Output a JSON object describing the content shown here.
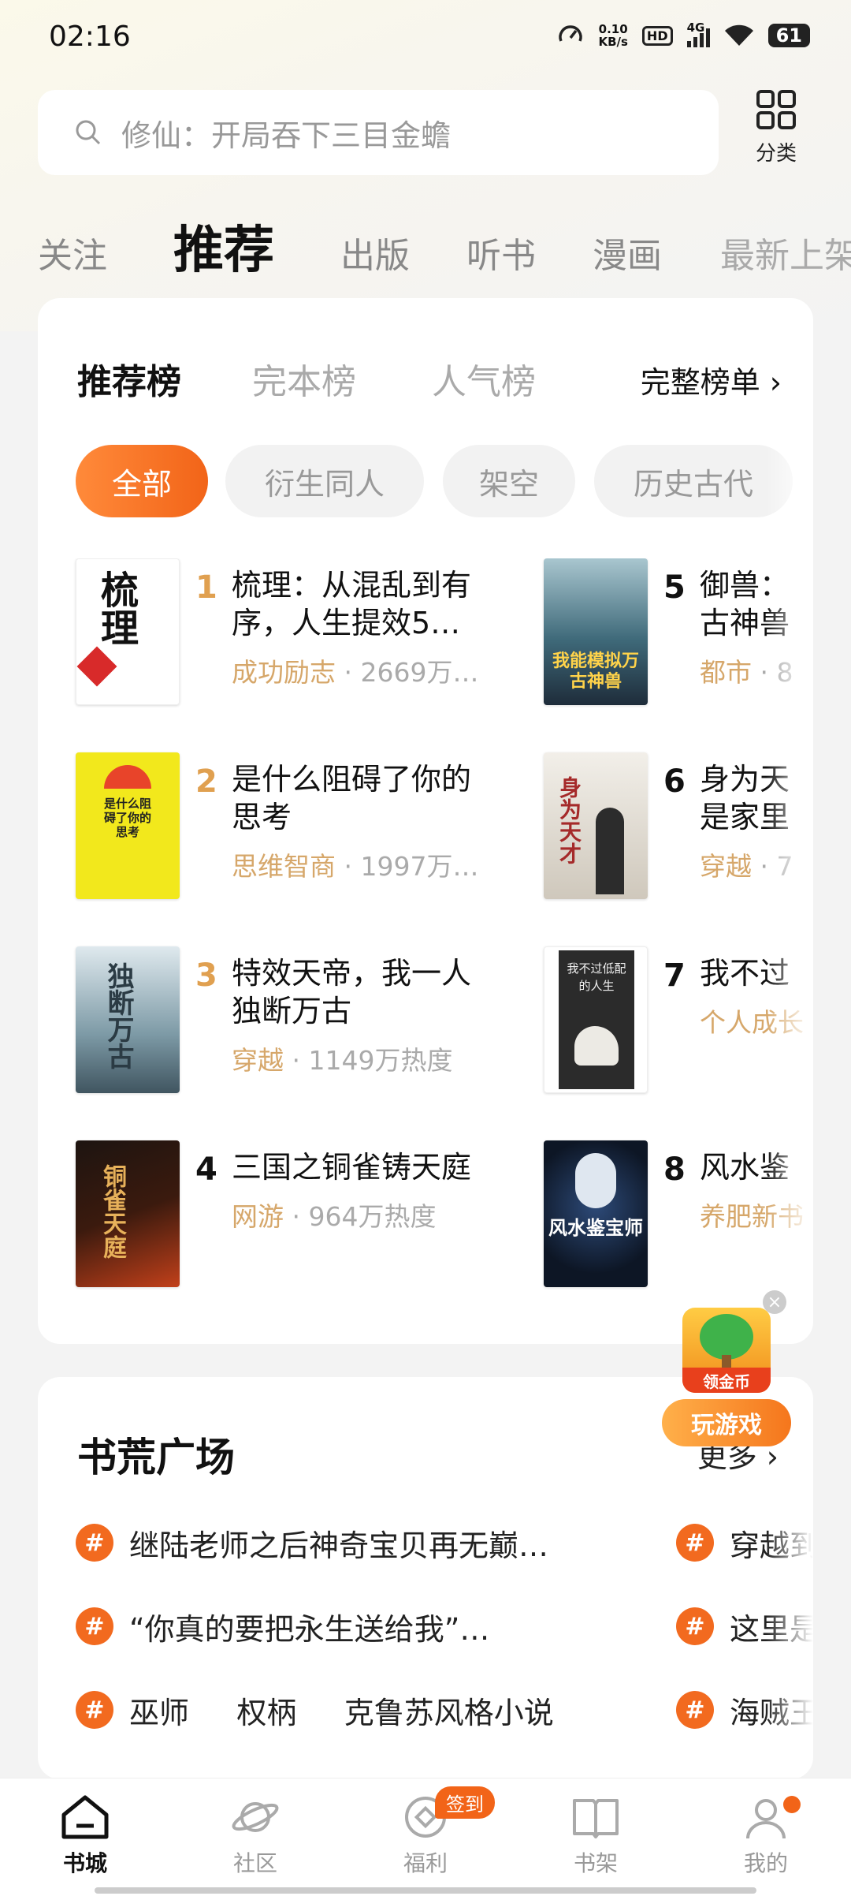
{
  "status": {
    "time": "02:16",
    "speed_value": "0.10",
    "speed_unit": "KB/s",
    "hd": "HD",
    "network": "4G",
    "battery": "61"
  },
  "search": {
    "placeholder": "修仙：开局吞下三目金蟾"
  },
  "category": {
    "label": "分类"
  },
  "tabs": [
    "关注",
    "推荐",
    "出版",
    "听书",
    "漫画",
    "最新上架"
  ],
  "ranking": {
    "tabs": [
      "推荐榜",
      "完本榜",
      "人气榜"
    ],
    "full_list": "完整榜单 ›",
    "chips": [
      "全部",
      "衍生同人",
      "架空",
      "历史古代"
    ],
    "books": [
      {
        "rank": "1",
        "title": "梳理：从混乱到有序，人生提效5…",
        "tag": "成功励志",
        "heat": " · 2669万…",
        "cover_text": "梳理"
      },
      {
        "rank": "2",
        "title": "是什么阻碍了你的思考",
        "tag": "思维智商",
        "heat": " · 1997万…",
        "cover_text": "是什么阻碍了你的思考"
      },
      {
        "rank": "3",
        "title": "特效天帝，我一人独断万古",
        "tag": "穿越",
        "heat": " · 1149万热度",
        "cover_text": "独断万古"
      },
      {
        "rank": "4",
        "title": "三国之铜雀铸天庭",
        "tag": "网游",
        "heat": " · 964万热度",
        "cover_text": "铜雀天庭"
      },
      {
        "rank": "5",
        "title": "御兽：",
        "title2": "古神兽",
        "tag": "都市",
        "heat": " · 8",
        "cover_text": "我能模拟万古神兽"
      },
      {
        "rank": "6",
        "title": "身为天",
        "title2": "是家里",
        "tag": "穿越",
        "heat": " · 7",
        "cover_text": "身为天才"
      },
      {
        "rank": "7",
        "title": "我不过",
        "tag": "个人成长",
        "heat": "",
        "cover_text": "我不过低配的人生"
      },
      {
        "rank": "8",
        "title": "风水鉴",
        "tag": "养肥新书",
        "heat": "",
        "cover_text": "风水鉴宝师"
      }
    ]
  },
  "plaza": {
    "title": "书荒广场",
    "more": "更多 ›",
    "topics_left": [
      "继陆老师之后神奇宝贝再无巅…",
      "“你真的要把永生送给我”…",
      "巫师     权柄     克鲁苏风格小说"
    ],
    "topics_right": [
      "穿越到",
      "这里是",
      "海贼王"
    ]
  },
  "float_game": {
    "coin_label": "领金币",
    "button": "玩游戏"
  },
  "nav": {
    "items": [
      "书城",
      "社区",
      "福利",
      "书架",
      "我的"
    ],
    "sign_badge": "签到"
  },
  "colors": {
    "accent": "#f26418",
    "tag": "#d6a76a",
    "rank_orange": "#e0a050"
  }
}
